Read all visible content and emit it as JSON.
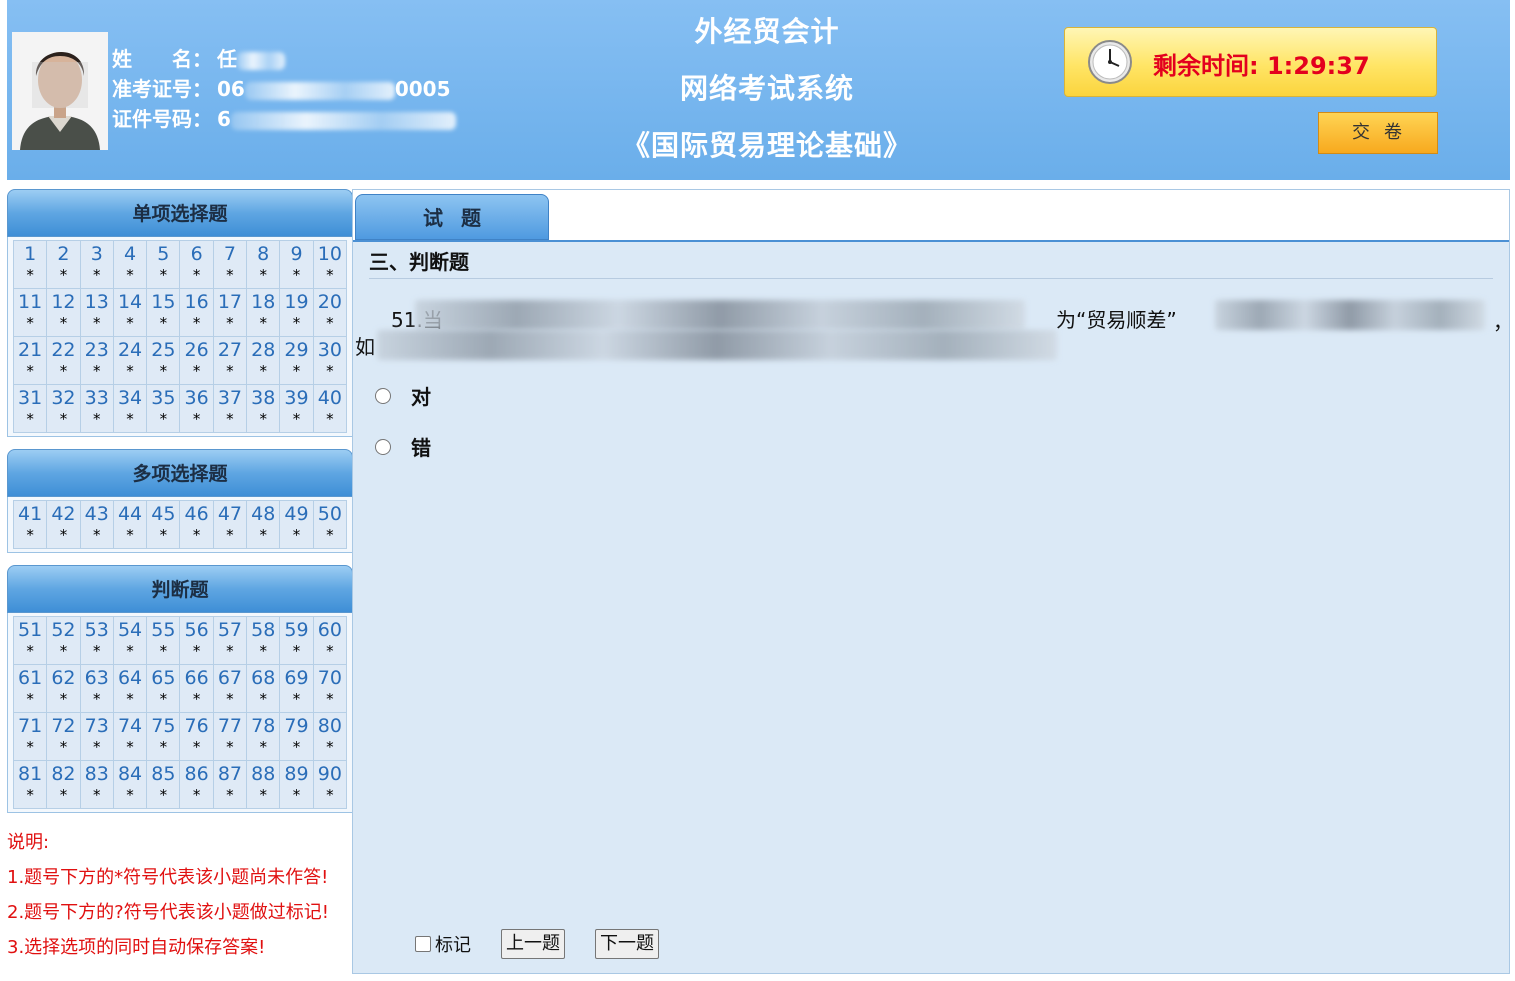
{
  "header": {
    "name_label": "姓　　名：",
    "name_value": "任",
    "exam_no_label": "准考证号：",
    "exam_no_value_start": "06",
    "exam_no_value_end": "0005",
    "id_no_label": "证件号码：",
    "id_no_value_start": "6",
    "title_line1": "外经贸会计",
    "title_line2": "网络考试系统",
    "title_line3": "《国际贸易理论基础》",
    "timer_label": "剩余时间:",
    "timer_value": "1:29:37",
    "submit_label": "交卷"
  },
  "left": {
    "sections": [
      {
        "title": "单项选择题",
        "start": 1,
        "end": 40
      },
      {
        "title": "多项选择题",
        "start": 41,
        "end": 50
      },
      {
        "title": "判断题",
        "start": 51,
        "end": 90
      }
    ],
    "unanswered_mark": "*",
    "notes": [
      "说明:",
      "1.题号下方的*符号代表该小题尚未作答!",
      "2.题号下方的?符号代表该小题做过标记!",
      "3.选择选项的同时自动保存答案!"
    ]
  },
  "main": {
    "tab_label": "试题",
    "section_title": "三、判断题",
    "question_prefix": "51.当",
    "question_fragment": "为“贸易顺差”",
    "question_line2_start": "如",
    "question_end": "，",
    "options": [
      "对",
      "错"
    ],
    "mark_label": "标记",
    "prev_label": "上一题",
    "next_label": "下一题"
  }
}
